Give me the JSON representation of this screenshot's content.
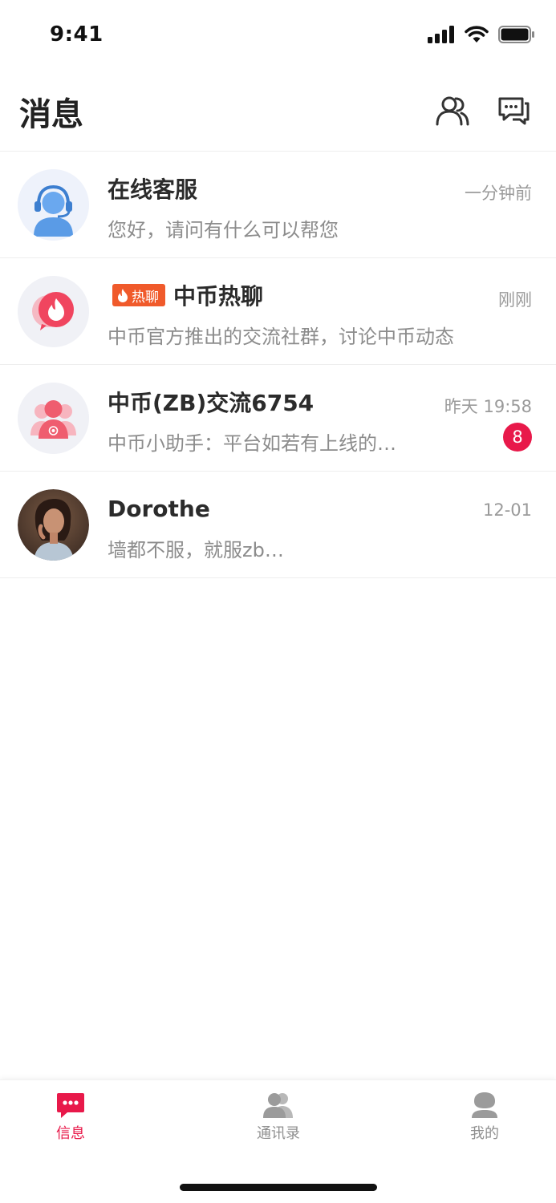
{
  "status_bar": {
    "time": "9:41"
  },
  "header": {
    "title": "消息"
  },
  "conversations": [
    {
      "name": "在线客服",
      "preview": "您好，请问有什么可以帮您",
      "time": "一分钟前"
    },
    {
      "tag": "热聊",
      "name": "中币热聊",
      "preview": "中币官方推出的交流社群，讨论中币动态",
      "time": "刚刚"
    },
    {
      "name": "中币(ZB)交流6754",
      "preview": "中币小助手：平台如若有上线的…",
      "time": "昨天 19:58",
      "unread": "8"
    },
    {
      "name": "Dorothe",
      "preview": "墙都不服，就服zb…",
      "time": "12-01"
    }
  ],
  "tabbar": {
    "tabs": [
      {
        "label": "信息",
        "icon": "message-icon",
        "active": true
      },
      {
        "label": "通讯录",
        "icon": "contacts-icon",
        "active": false
      },
      {
        "label": "我的",
        "icon": "profile-icon",
        "active": false
      }
    ]
  },
  "colors": {
    "accent": "#e8194a",
    "hot_tag": "#f05a2b",
    "text_secondary": "#8c8c8c"
  }
}
